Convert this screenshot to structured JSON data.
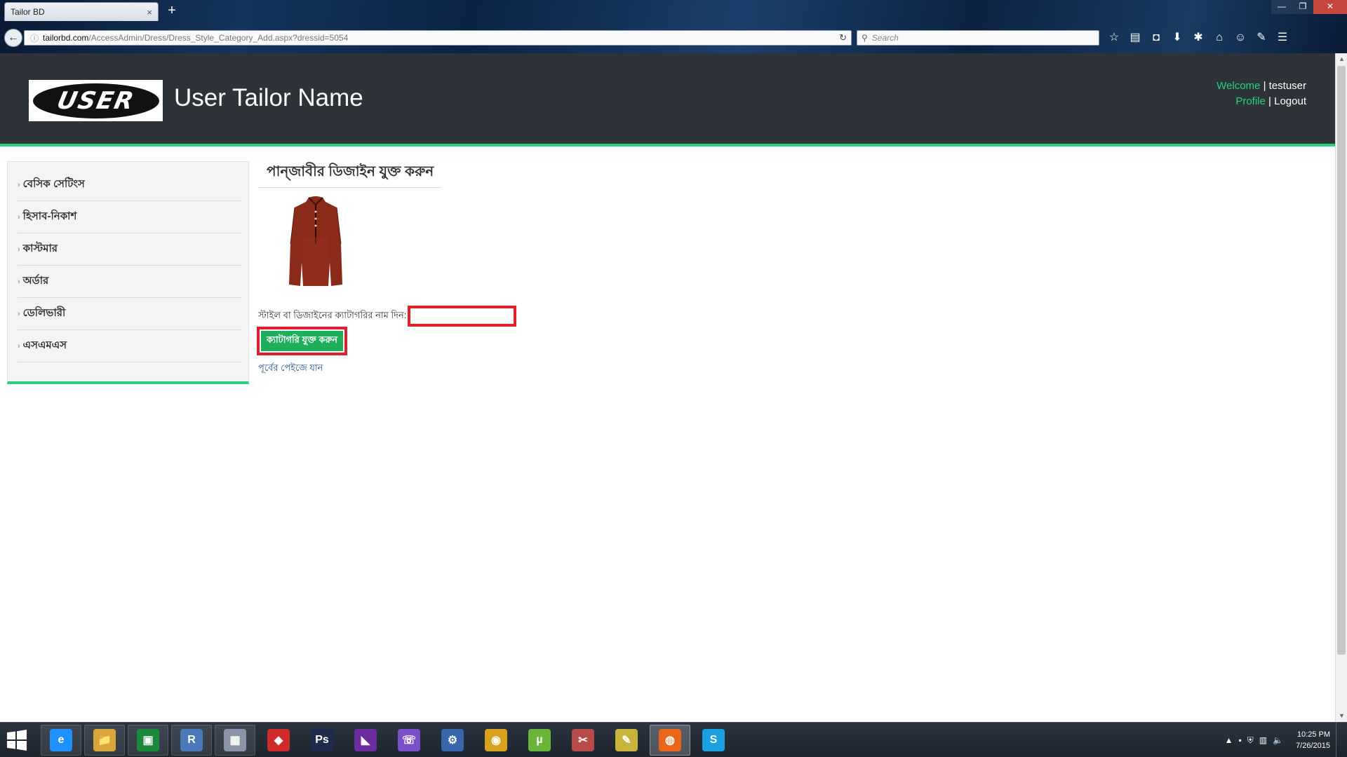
{
  "browser": {
    "tab_title": "Tailor BD",
    "tab_close": "×",
    "new_tab": "+",
    "url_host": "tailorbd.com",
    "url_path": "/AccessAdmin/Dress/Dress_Style_Category_Add.aspx?dressid=5054",
    "search_placeholder": "Search",
    "icons": [
      "bookmark-star-icon",
      "reading-list-icon",
      "pocket-icon",
      "download-icon",
      "addon-icon",
      "home-icon",
      "chat-icon",
      "pen-icon",
      "menu-icon"
    ]
  },
  "header": {
    "logo_text": "USER",
    "site_title": "User Tailor Name",
    "welcome_label": "Welcome",
    "separator": "|",
    "username": "testuser",
    "profile_label": "Profile",
    "logout_label": "Logout",
    "accent_color": "#27d17d"
  },
  "sidebar": {
    "items": [
      {
        "label": "বেসিক সেটিংস"
      },
      {
        "label": "হিসাব-নিকাশ"
      },
      {
        "label": "কাস্টমার"
      },
      {
        "label": "অর্ডার"
      },
      {
        "label": "ডেলিভারী"
      },
      {
        "label": "এসএমএস"
      }
    ]
  },
  "main": {
    "heading": "পান্জাবীর ডিজাইন যুক্ত করুন",
    "form_label": "স্টাইল বা ডিজাইনের ক্যাটাগরির নাম দিন:",
    "category_value": "",
    "add_button_label": "ক্যাটাগরি যুক্ত করুন",
    "back_link_label": "পূর্বের পেইজে যান",
    "highlight_color": "#e0202a"
  },
  "taskbar": {
    "apps": [
      {
        "name": "internet-explorer",
        "glyph": "e",
        "color": "#1e90ff"
      },
      {
        "name": "file-explorer",
        "glyph": "📁",
        "color": "#d9a53a"
      },
      {
        "name": "store",
        "glyph": "▣",
        "color": "#1a8a3a"
      },
      {
        "name": "remote-app",
        "glyph": "R",
        "color": "#4a78b8"
      },
      {
        "name": "calculator",
        "glyph": "▦",
        "color": "#8a96a8"
      },
      {
        "name": "red-app",
        "glyph": "◆",
        "color": "#d12a2a"
      },
      {
        "name": "photoshop",
        "glyph": "Ps",
        "color": "#1d2c4a"
      },
      {
        "name": "visual-studio",
        "glyph": "◣",
        "color": "#6a2c9e"
      },
      {
        "name": "viber",
        "glyph": "☏",
        "color": "#7a4fc8"
      },
      {
        "name": "network-tool",
        "glyph": "⚙",
        "color": "#3a66b0"
      },
      {
        "name": "chrome",
        "glyph": "◉",
        "color": "#d8a21c"
      },
      {
        "name": "utorrent",
        "glyph": "µ",
        "color": "#6ab43a"
      },
      {
        "name": "snipping-tool",
        "glyph": "✂",
        "color": "#b84a4a"
      },
      {
        "name": "paint-tool",
        "glyph": "✎",
        "color": "#c8b43a"
      },
      {
        "name": "firefox",
        "glyph": "◍",
        "color": "#e8651a",
        "active": true
      },
      {
        "name": "skype",
        "glyph": "S",
        "color": "#1ba1e2"
      }
    ],
    "time": "10:25 PM",
    "date": "7/26/2015"
  }
}
